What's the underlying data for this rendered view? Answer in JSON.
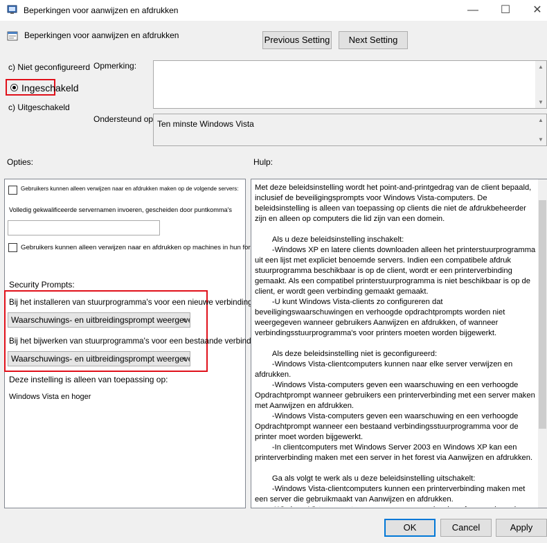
{
  "window": {
    "title": "Beperkingen voor aanwijzen en afdrukken",
    "minimize_icon": "minimize-icon",
    "maximize_icon": "maximize-icon",
    "close_icon": "close-icon"
  },
  "header": {
    "policy_name": "Beperkingen voor aanwijzen en afdrukken",
    "previous_label": "Previous Setting",
    "next_label": "Next Setting"
  },
  "state": {
    "not_configured": "Niet geconfigureerd",
    "enabled": "Ingeschakeld",
    "disabled": "Uitgeschakeld",
    "selected": "enabled",
    "radio_prefix": "c)"
  },
  "comment": {
    "label": "Opmerking:",
    "value": ""
  },
  "supported": {
    "label": "Ondersteund op:",
    "value": "Ten minste Windows Vista"
  },
  "options": {
    "label": "Opties:",
    "checkbox1_label": "Gebruikers kunnen alleen verwijzen naar en afdrukken maken op de volgende servers:",
    "servers_hint": "Volledig gekwalificeerde servernamen invoeren, gescheiden door puntkomma's",
    "servers_value": "",
    "checkbox2_label": "Gebruikers kunnen alleen verwijzen naar en afdrukken op machines in hun forest",
    "security_prompts_label": "Security Prompts:",
    "install_label": "Bij het installeren van stuurprogramma's voor een nieuwe verbinding:",
    "install_value": "Waarschuwings- en uitbreidingsprompt weergeven",
    "update_label": "Bij het bijwerken van stuurprogramma's voor een bestaande verbinding:",
    "update_value": "Waarschuwings- en uitbreidingsprompt weergeven",
    "applies_label": "Deze instelling is alleen van toepassing op:",
    "applies_value": "Windows Vista en hoger"
  },
  "help": {
    "label": "Hulp:",
    "paragraphs": [
      "Met deze beleidsinstelling wordt het point-and-printgedrag van de client bepaald, inclusief de beveiligingsprompts voor Windows Vista-computers. De beleidsinstelling is alleen van toepassing op clients die niet de afdrukbeheerder zijn en alleen op computers die lid zijn van een domein.",
      "",
      "        Als u deze beleidsinstelling inschakelt:",
      "        -Windows XP en latere clients downloaden alleen het printerstuurprogramma uit een lijst met expliciet benoemde servers. Indien een compatibele afdruk stuurprogramma beschikbaar is op de client, wordt er een printerverbinding gemaakt. Als een compatibel printerstuurprogramma is niet beschikbaar is op de client, er wordt geen verbinding gemaakt gemaakt.",
      "        -U kunt Windows Vista-clients zo configureren dat beveiligingswaarschuwingen en verhoogde opdrachtprompts worden niet weergegeven wanneer gebruikers Aanwijzen en afdrukken, of wanneer verbindingsstuurprogramma's voor printers moeten worden bijgewerkt.",
      "",
      "        Als deze beleidsinstelling niet is geconfigureerd:",
      "        -Windows Vista-clientcomputers kunnen naar elke server verwijzen en afdrukken.",
      "        -Windows Vista-computers geven een waarschuwing en een verhoogde Opdrachtprompt wanneer gebruikers een printerverbinding met een server maken met Aanwijzen en afdrukken.",
      "        -Windows Vista-computers geven een waarschuwing en een verhoogde Opdrachtprompt wanneer een bestaand verbindingsstuurprogramma voor de printer moet worden bijgewerkt.",
      "        -In clientcomputers met Windows Server 2003 en Windows XP kan een printerverbinding maken met een server in het forest via Aanwijzen en afdrukken.",
      "",
      "        Ga als volgt te werk als u deze beleidsinstelling uitschakelt:",
      "        -Windows Vista-clientcomputers kunnen een printerverbinding maken met een server die gebruikmaakt van Aanwijzen en afdrukken.",
      "        -Windows Vista-computers geven geen waarschuwing of een verhoogde Opdrachtprompt wanneer gebruikers een printerverbinding met een server maken"
    ]
  },
  "footer": {
    "ok": "OK",
    "cancel": "Cancel",
    "apply": "Apply"
  },
  "colors": {
    "highlight_border": "#e0101a",
    "focus": "#0078d7"
  }
}
